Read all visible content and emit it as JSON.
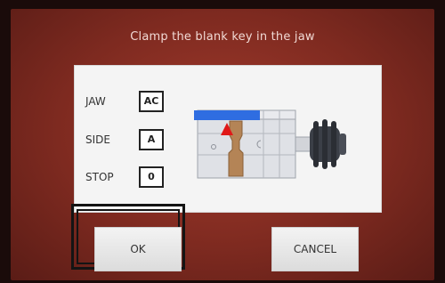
{
  "instruction": "Clamp the blank key in the jaw",
  "params": [
    {
      "label": "JAW",
      "value": "AC"
    },
    {
      "label": "SIDE",
      "value": "A"
    },
    {
      "label": "STOP",
      "value": "0"
    }
  ],
  "buttons": {
    "ok_label": "OK",
    "cancel_label": "CANCEL"
  },
  "colors": {
    "background": "#8b2e22",
    "key_blue": "#2f6de1",
    "stop_marker": "#e01818",
    "clamp_tan": "#b48456"
  }
}
